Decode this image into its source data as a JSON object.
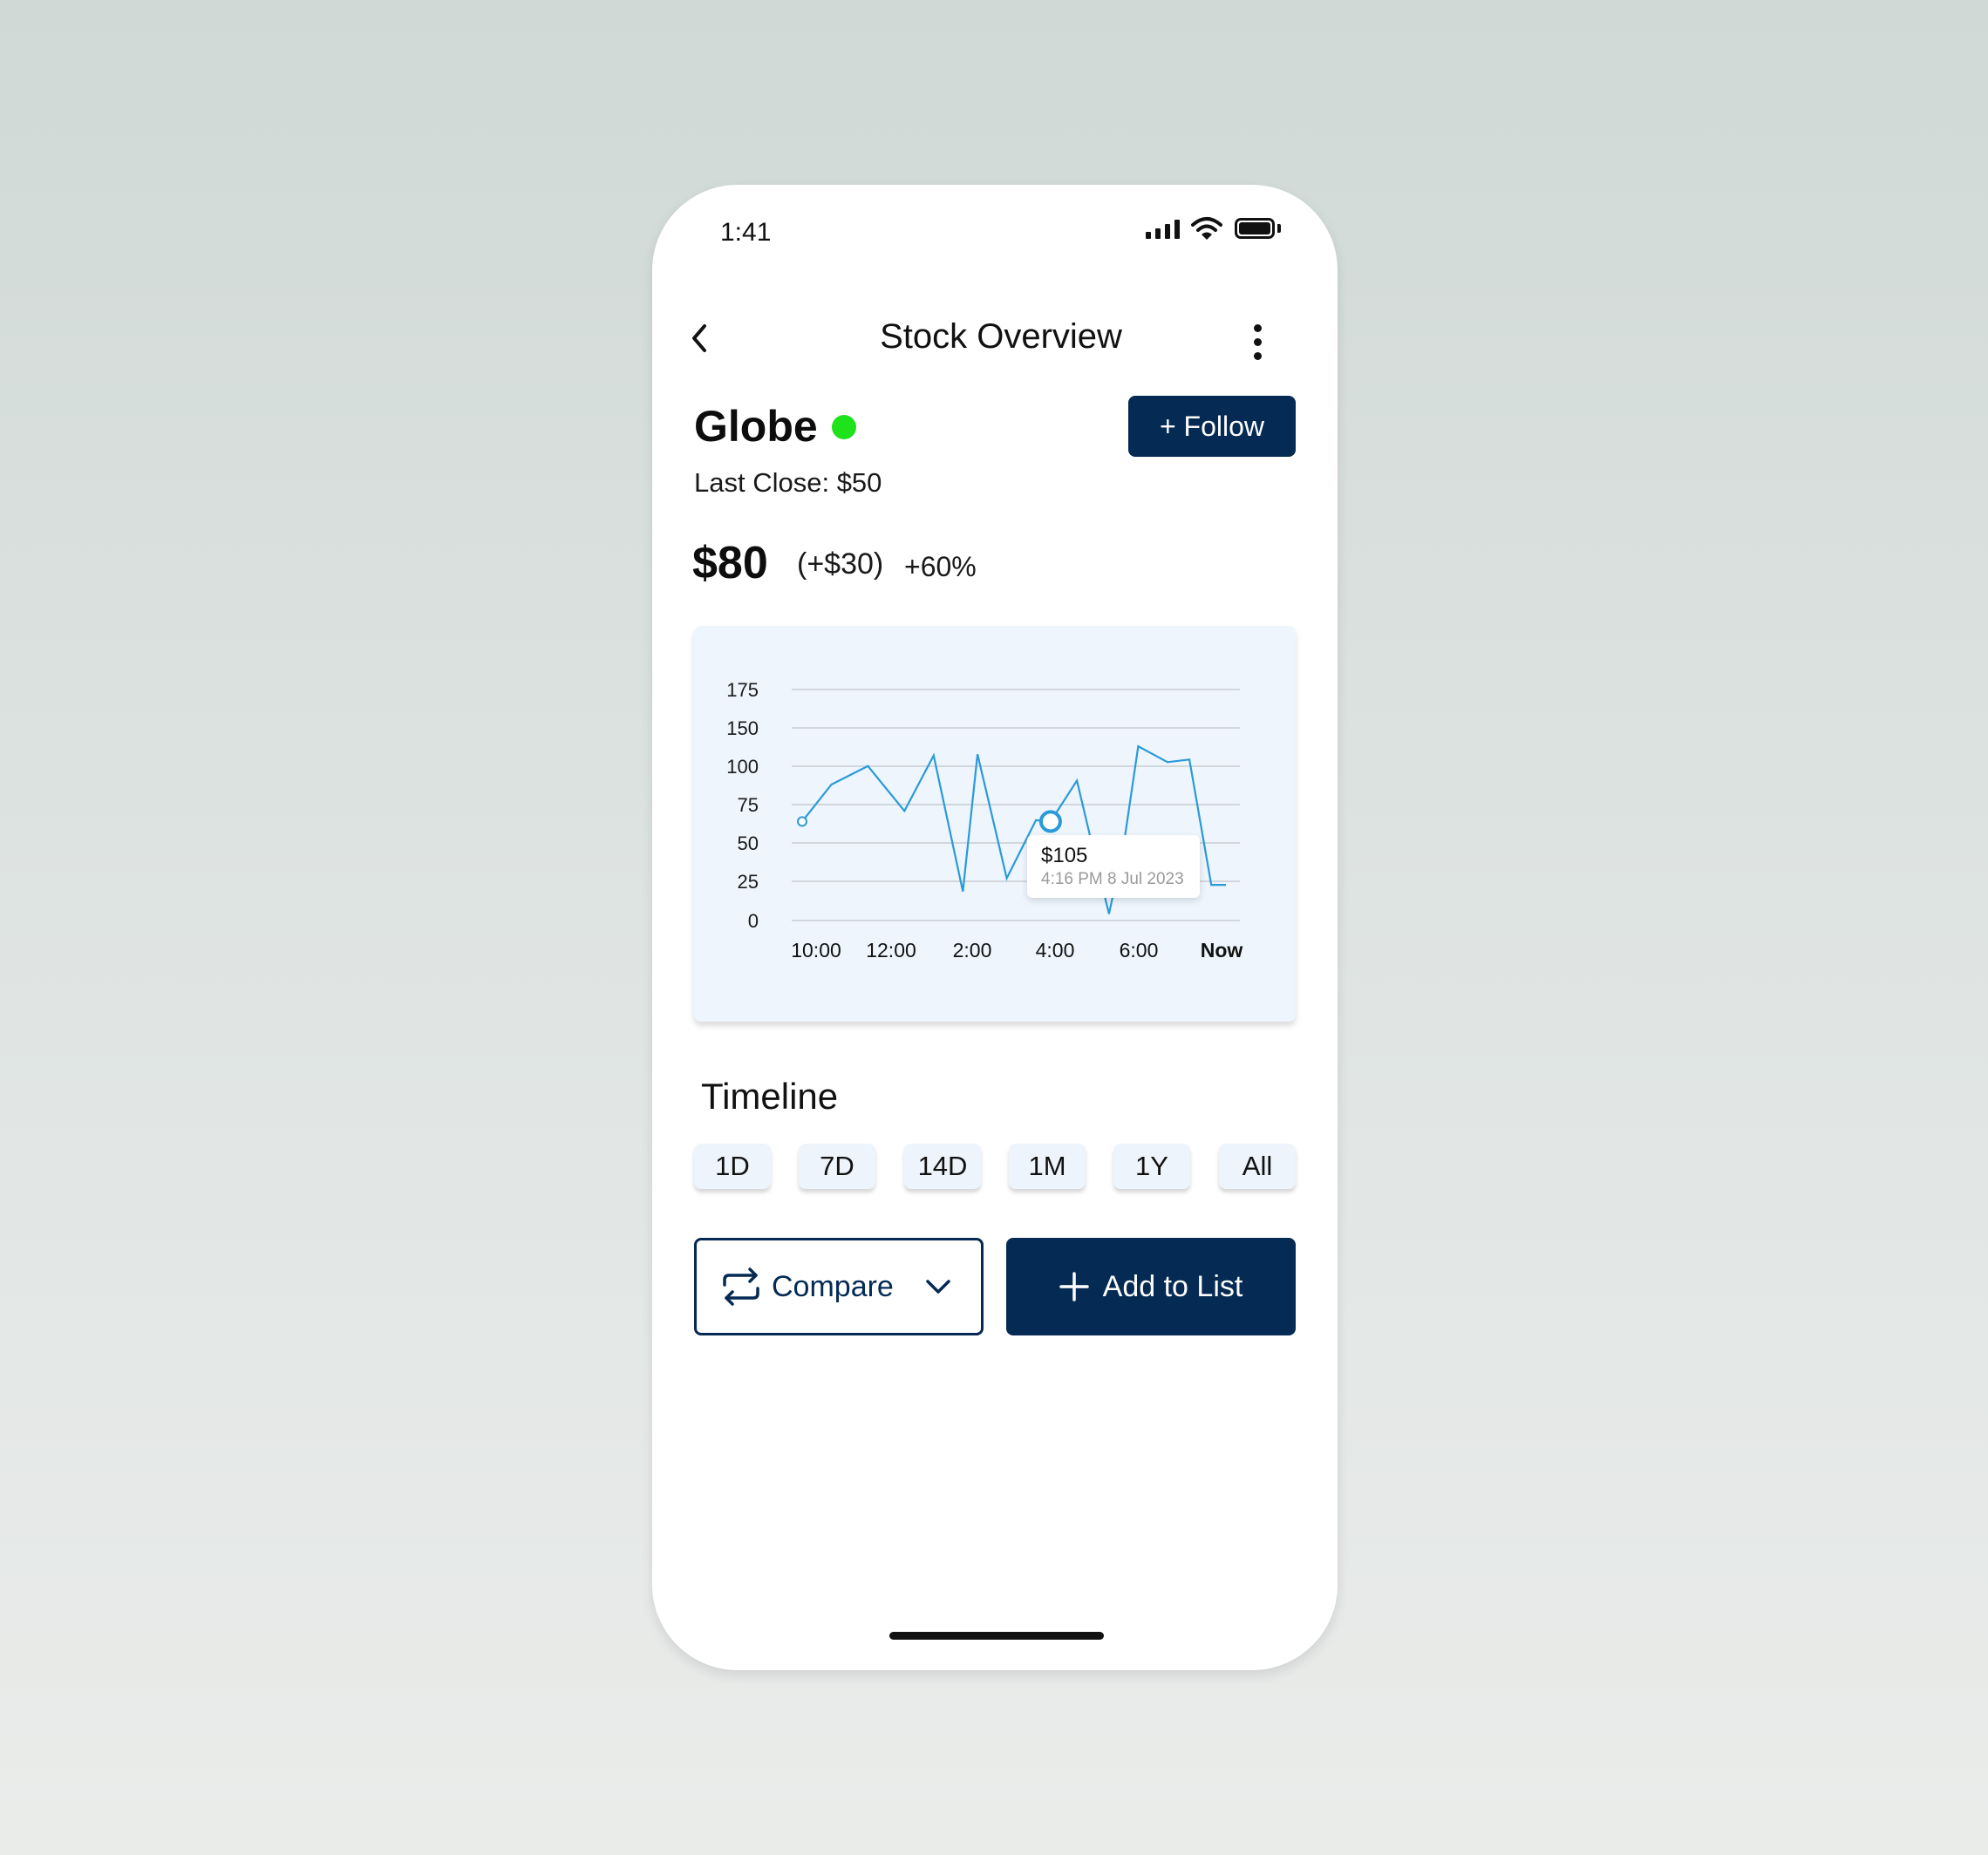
{
  "status_bar": {
    "time": "1:41",
    "icons": [
      "signal-icon",
      "wifi-icon",
      "battery-icon"
    ]
  },
  "header": {
    "title": "Stock Overview",
    "back_icon": "chevron-left-icon",
    "more_icon": "more-vertical-icon"
  },
  "stock": {
    "name": "Globe",
    "live_indicator_color": "#1ee21a",
    "follow_label": "+ Follow",
    "last_close": "Last Close: $50",
    "price": "$80",
    "change_abs": "(+$30)",
    "change_pct": "+60%"
  },
  "chart": {
    "tooltip": {
      "price": "$105",
      "time": "4:16 PM",
      "date": "8 Jul 2023"
    }
  },
  "chart_data": {
    "type": "line",
    "y_ticks": [
      "175",
      "150",
      "100",
      "75",
      "50",
      "25",
      "0"
    ],
    "x_ticks": [
      "10:00",
      "12:00",
      "2:00",
      "4:00",
      "6:00",
      "Now"
    ],
    "line_color": "#2a9ad8",
    "grid": true,
    "highlight_index": 9,
    "series": [
      {
        "x": [
          "10:00",
          "10:40",
          "11:30",
          "12:20",
          "13:00",
          "13:40",
          "14:00",
          "14:40",
          "15:20",
          "15:40",
          "16:16",
          "16:40",
          "17:00",
          "17:20",
          "17:40",
          "18:20",
          "18:50",
          "19:20",
          "19:40"
        ],
        "values": [
          75,
          103,
          117,
          83,
          125,
          22,
          126,
          32,
          76,
          75,
          106,
          50,
          5,
          57,
          132,
          120,
          122,
          27,
          27
        ]
      }
    ]
  },
  "timeline": {
    "title": "Timeline",
    "buttons": [
      "1D",
      "7D",
      "14D",
      "1M",
      "1Y",
      "All"
    ]
  },
  "actions": {
    "compare_label": "Compare",
    "add_label": "Add to List"
  }
}
